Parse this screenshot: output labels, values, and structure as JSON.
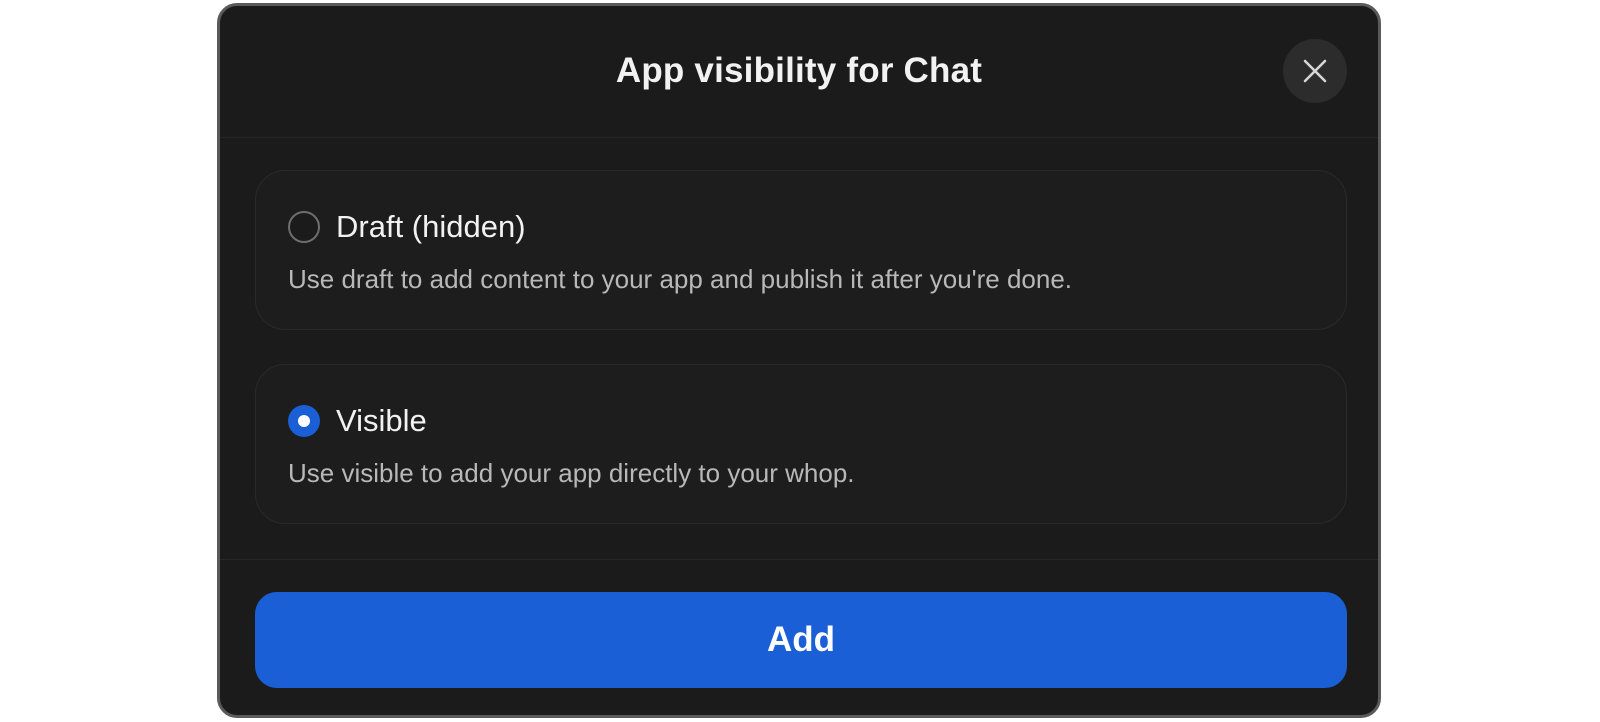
{
  "dialog": {
    "title": "App visibility for Chat",
    "close_icon": "close-icon"
  },
  "options": [
    {
      "label": "Draft (hidden)",
      "description": "Use draft to add content to your app and publish it after you're done.",
      "selected": false
    },
    {
      "label": "Visible",
      "description": "Use visible to add your app directly to your whop.",
      "selected": true
    }
  ],
  "actions": {
    "add_label": "Add"
  },
  "colors": {
    "accent": "#1a5fd6",
    "background": "#1b1b1b",
    "border": "#5a5a5a"
  }
}
